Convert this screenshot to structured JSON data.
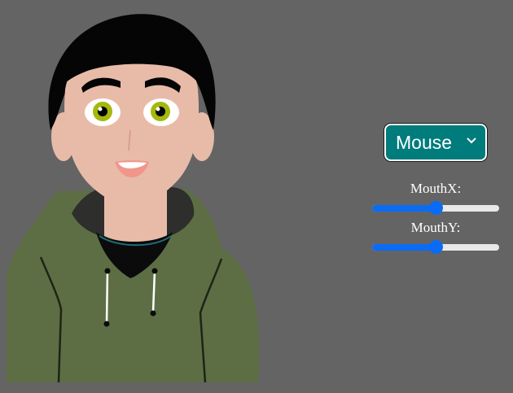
{
  "mode_select": {
    "selected": "Mouse"
  },
  "sliders": [
    {
      "label": "MouthX:",
      "value": 0.5
    },
    {
      "label": "MouthY:",
      "value": 0.5
    }
  ],
  "colors": {
    "background": "#656464",
    "hair": "#050505",
    "skin": "#e8bba9",
    "hoodie": "#5d6e45",
    "hood_lining": "#2e2e2c",
    "shirt": "#0b0b0b",
    "iris": "#a5b80e",
    "select_bg": "#007c7c",
    "slider_accent": "#0a6cf5",
    "slider_track": "#e9e9e9"
  }
}
